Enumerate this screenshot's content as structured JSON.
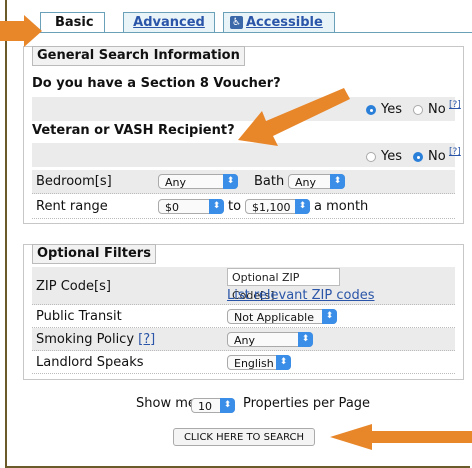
{
  "tabs": [
    {
      "label": "Basic"
    },
    {
      "label": "Advanced"
    },
    {
      "label": "Accessible",
      "icon": "accessibility-icon"
    }
  ],
  "general": {
    "legend": "General Search Information",
    "section8_question": "Do you have a Section 8 Voucher?",
    "section8_yes": "Yes",
    "section8_no": "No",
    "section8_selected": "Yes",
    "veteran_question": "Veteran or VASH Recipient?",
    "veteran_yes": "Yes",
    "veteran_no": "No",
    "veteran_selected": "No",
    "help_label": "[?]",
    "bedroom_label": "Bedroom[s]",
    "bedroom_value": "Any",
    "bath_label": "Bath",
    "bath_value": "Any",
    "rent_label": "Rent range",
    "rent_min": "$0",
    "rent_to": "to",
    "rent_max": "$1,100",
    "rent_suffix": "a month"
  },
  "optional": {
    "legend": "Optional Filters",
    "zip_label": "ZIP Code[s]",
    "zip_placeholder": "Optional ZIP Code[s]",
    "zip_link": "List relevant ZIP codes",
    "transit_label": "Public Transit",
    "transit_value": "Not Applicable",
    "smoking_label": "Smoking Policy",
    "smoking_help": "[?]",
    "smoking_value": "Any",
    "landlord_label": "Landlord Speaks",
    "landlord_value": "English"
  },
  "paging": {
    "prefix": "Show me",
    "value": "10",
    "suffix": "Properties per Page"
  },
  "search_button": "CLICK HERE TO SEARCH",
  "colors": {
    "arrow": "#e8862a",
    "accent": "#2a7fd9"
  }
}
